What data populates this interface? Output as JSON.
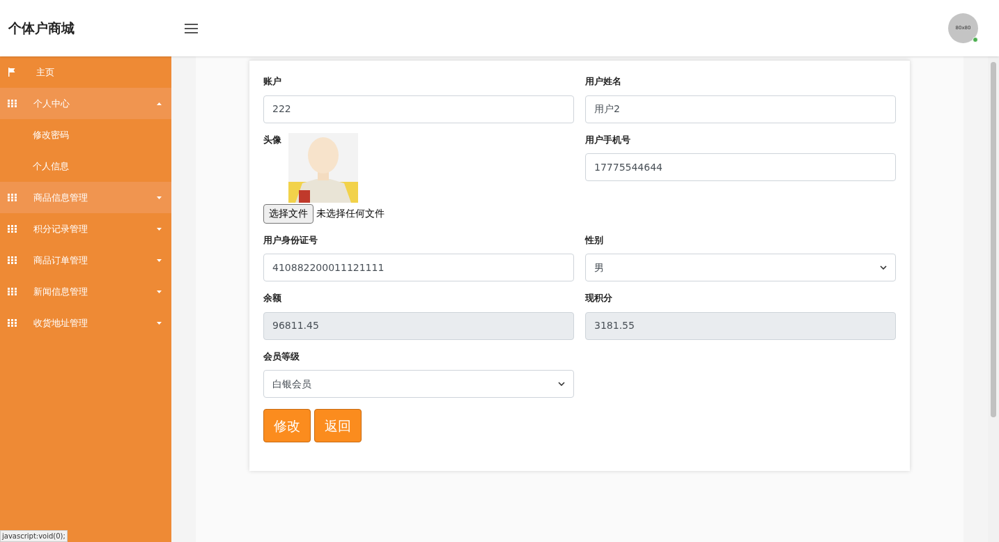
{
  "header": {
    "title": "个体户商城",
    "avatar_label": "80x80",
    "online": true
  },
  "sidebar": {
    "items": [
      {
        "kind": "link",
        "label": "主页",
        "selected": false
      },
      {
        "kind": "menu",
        "label": "个人中心",
        "selected": true,
        "expanded": true,
        "children": [
          {
            "label": "修改密码"
          },
          {
            "label": "个人信息"
          }
        ]
      },
      {
        "kind": "menu",
        "label": "商品信息管理",
        "selected": true,
        "expanded": false
      },
      {
        "kind": "menu",
        "label": "积分记录管理",
        "selected": false,
        "expanded": false
      },
      {
        "kind": "menu",
        "label": "商品订单管理",
        "selected": false,
        "expanded": false
      },
      {
        "kind": "menu",
        "label": "新闻信息管理",
        "selected": false,
        "expanded": false
      },
      {
        "kind": "menu",
        "label": "收货地址管理",
        "selected": false,
        "expanded": false
      }
    ]
  },
  "form": {
    "fields": [
      {
        "kind": "text",
        "label": "账户",
        "value": "222",
        "disabled": false
      },
      {
        "kind": "text",
        "label": "用户姓名",
        "value": "用户2",
        "disabled": false
      },
      {
        "label": "头像",
        "button": "选择文件",
        "status": "未选择任何文件"
      },
      {
        "kind": "text",
        "label": "用户手机号",
        "value": "17775544644",
        "disabled": false
      },
      {
        "kind": "text",
        "label": "用户身份证号",
        "value": "410882200011121111",
        "disabled": false
      },
      {
        "kind": "select",
        "label": "性别",
        "value": "男",
        "disabled": false
      },
      {
        "kind": "text",
        "label": "余额",
        "value": "96811.45",
        "disabled": true
      },
      {
        "kind": "text",
        "label": "现积分",
        "value": "3181.55",
        "disabled": true
      },
      {
        "kind": "select",
        "label": "会员等级",
        "value": "白银会员",
        "disabled": false
      }
    ],
    "buttons": [
      "修改",
      "返回"
    ]
  },
  "status_bar": {
    "text": "javascript:void(0);"
  }
}
